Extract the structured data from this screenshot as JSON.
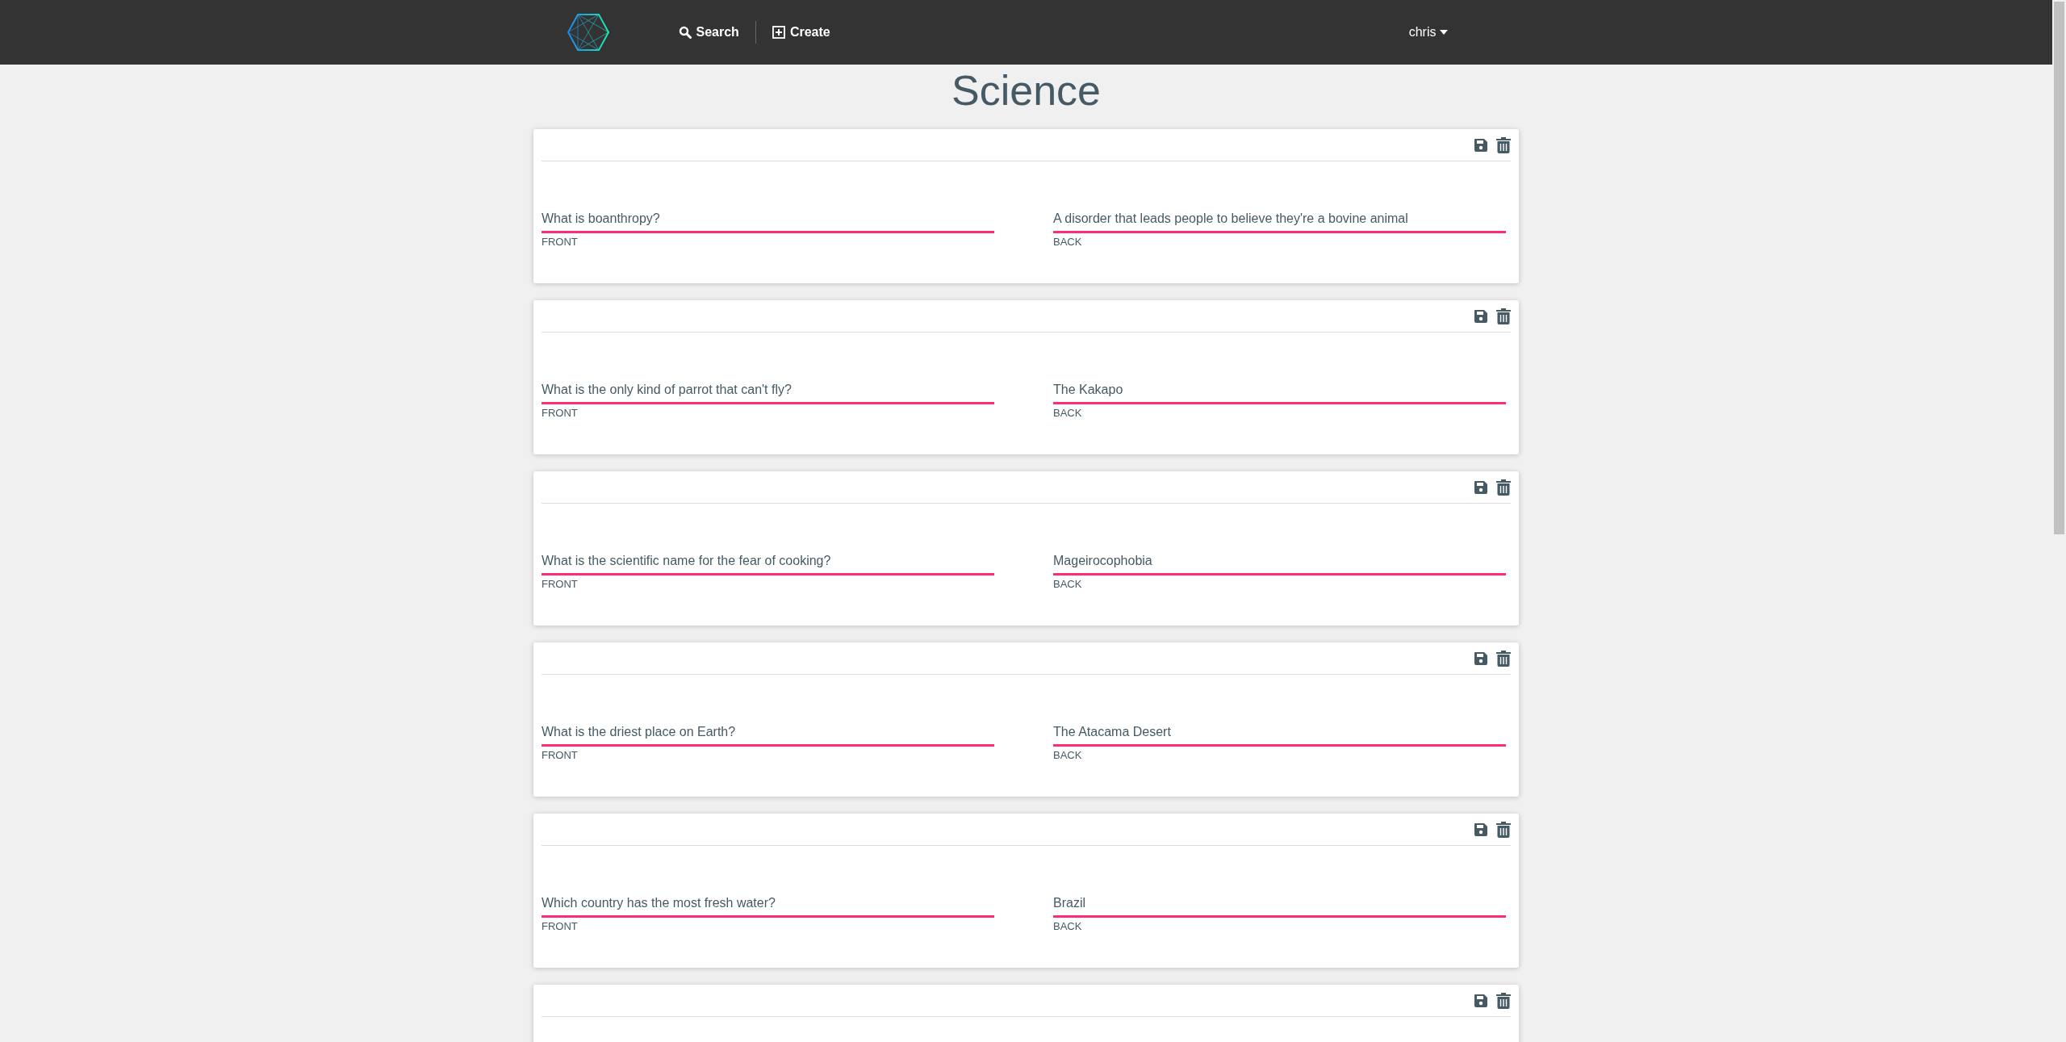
{
  "navbar": {
    "links": [
      {
        "kind": "search",
        "label": "Search"
      },
      {
        "kind": "create",
        "label": "Create"
      }
    ],
    "user": {
      "label": "chris"
    }
  },
  "title": "Science",
  "cards": [
    {
      "front": {
        "value": "What is boanthropy?",
        "label": "FRONT"
      },
      "back": {
        "value": "A disorder that leads people to believe they're a bovine animal",
        "label": "BACK"
      }
    },
    {
      "front": {
        "value": "What is the only kind of parrot that can't fly?",
        "label": "FRONT"
      },
      "back": {
        "value": "The Kakapo",
        "label": "BACK"
      }
    },
    {
      "front": {
        "value": "What is the scientific name for the fear of cooking?",
        "label": "FRONT"
      },
      "back": {
        "value": "Mageirocophobia",
        "label": "BACK"
      }
    },
    {
      "front": {
        "value": "What is the driest place on Earth?",
        "label": "FRONT"
      },
      "back": {
        "value": "The Atacama Desert",
        "label": "BACK"
      }
    },
    {
      "front": {
        "value": "Which country has the most fresh water?",
        "label": "FRONT"
      },
      "back": {
        "value": "Brazil",
        "label": "BACK"
      }
    }
  ],
  "more_cards_below": true
}
